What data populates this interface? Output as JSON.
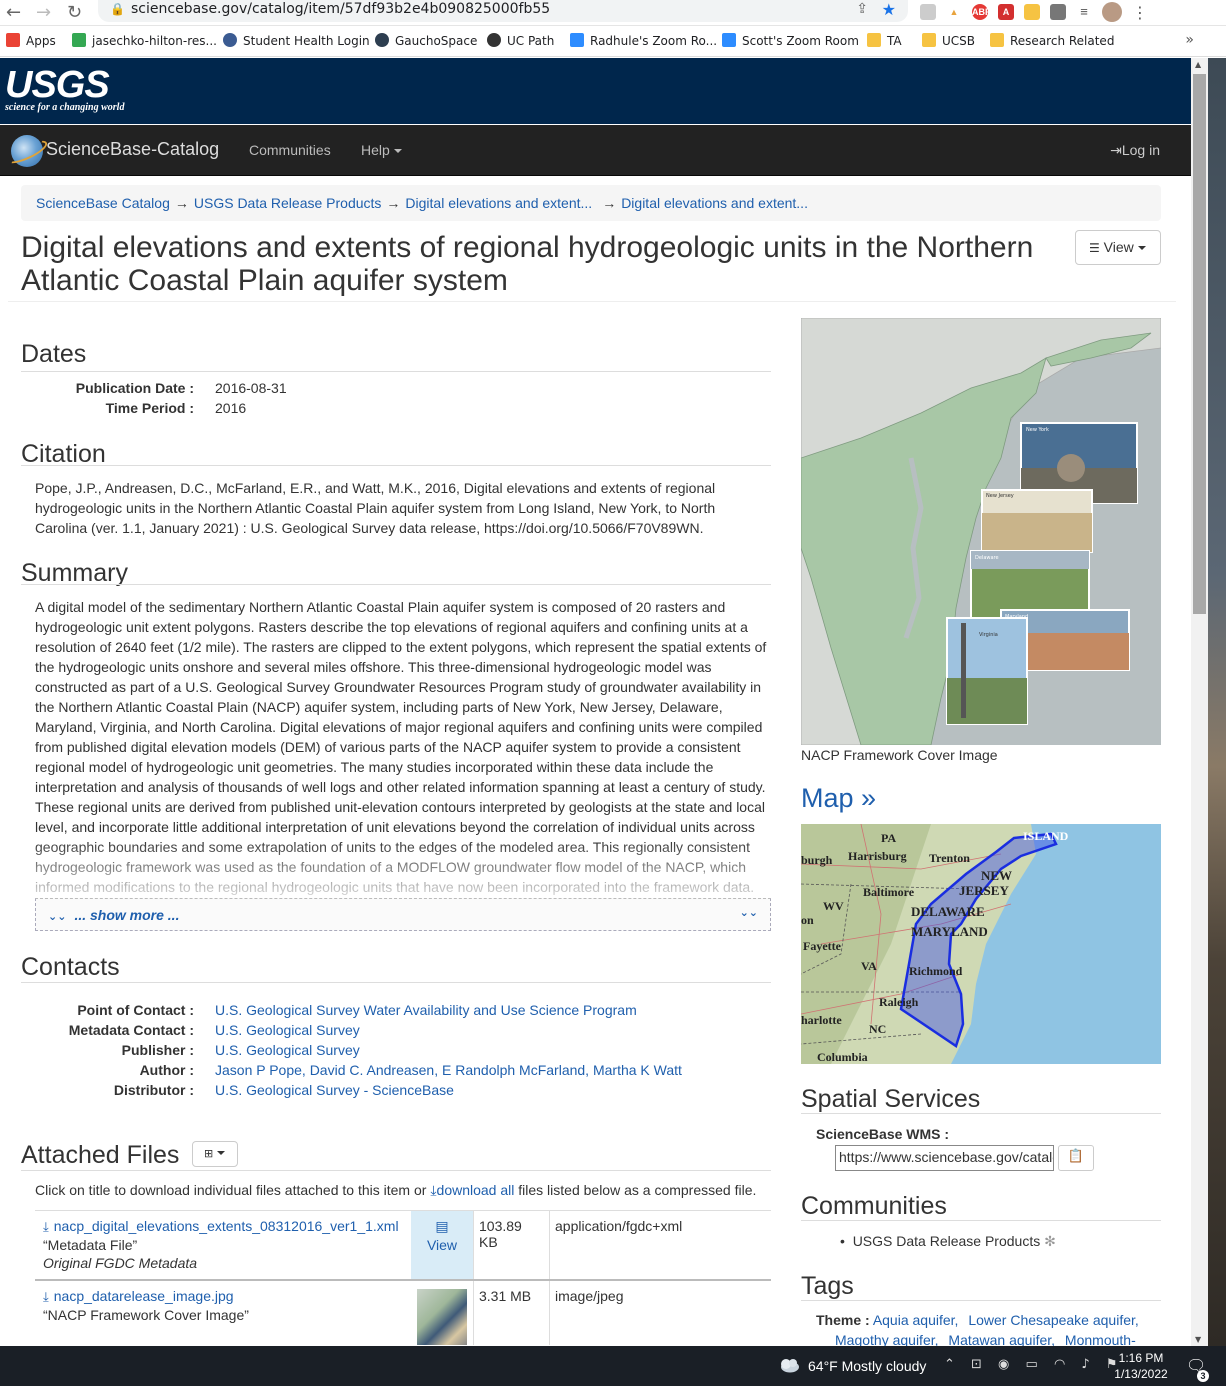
{
  "browser": {
    "url": "sciencebase.gov/catalog/item/57df93b2e4b090825000fb55",
    "bookmarks": [
      {
        "label": "Apps",
        "color": "#ea4335"
      },
      {
        "label": "jasechko-hilton-res...",
        "color": "#34a853"
      },
      {
        "label": "Student Health Login",
        "color": "#3b5b92"
      },
      {
        "label": "GauchoSpace",
        "color": "#2d3e50"
      },
      {
        "label": "UC Path",
        "color": "#333333"
      },
      {
        "label": "Radhule's Zoom Ro...",
        "color": "#2d8cff"
      },
      {
        "label": "Scott's Zoom Room",
        "color": "#2d8cff"
      },
      {
        "label": "TA",
        "color": "#f6c342"
      },
      {
        "label": "UCSB",
        "color": "#f6c342"
      },
      {
        "label": "Research Related",
        "color": "#f6c342"
      }
    ],
    "bookmarks_more": "»"
  },
  "usgs": {
    "wordmark": "USGS",
    "tagline": "science for a changing world"
  },
  "navbar": {
    "brand": "ScienceBase-Catalog",
    "communities": "Communities",
    "help": "Help",
    "login": "Log in"
  },
  "breadcrumb": [
    "ScienceBase Catalog",
    "USGS Data Release Products",
    "Digital elevations and extent...",
    "Digital elevations and extent..."
  ],
  "breadcrumb_sep": "→",
  "title": "Digital elevations and extents of regional hydrogeologic units in the Northern Atlantic Coastal Plain aquifer system",
  "view_button": "View",
  "dates": {
    "heading": "Dates",
    "publication_label": "Publication Date :",
    "publication_value": "2016-08-31",
    "period_label": "Time Period :",
    "period_value": "2016"
  },
  "citation": {
    "heading": "Citation",
    "text": "Pope, J.P., Andreasen, D.C., McFarland, E.R., and Watt, M.K., 2016, Digital elevations and extents of regional hydrogeologic units in the Northern Atlantic Coastal Plain aquifer system from Long Island, New York, to North Carolina (ver. 1.1, January 2021) : U.S. Geological Survey data release, https://doi.org/10.5066/F70V89WN."
  },
  "summary": {
    "heading": "Summary",
    "text": "A digital model of the sedimentary Northern Atlantic Coastal Plain aquifer system is composed of 20 rasters and hydrogeologic unit extent polygons. Rasters describe the top elevations of regional aquifers and confining units at a resolution of 2640 feet (1/2 mile). The rasters are clipped to the extent polygons, which represent the spatial extents of the hydrogeologic units onshore and several miles offshore. This three-dimensional hydrogeologic model was constructed as part of a U.S. Geological Survey Groundwater Resources Program study of groundwater availability in the Northern Atlantic Coastal Plain (NACP) aquifer system, including parts of New York, New Jersey, Delaware, Maryland, Virginia, and North Carolina. Digital elevations of major regional aquifers and confining units were compiled from published digital elevation models (DEM) of various parts of the NACP aquifer system to provide a consistent regional model of hydrogeologic unit geometries. The many studies incorporated within these data include the interpretation and analysis of thousands of well logs and other related information spanning at least a century of study. These regional units are derived from published unit-elevation contours interpreted by geologists at the state and local level, and incorporate little additional interpretation of unit elevations beyond the correlation of individual units across geographic boundaries and some extrapolation of units to the edges of the modeled area. This regionally consistent hydrogeologic framework was used as the foundation of a MODFLOW groundwater flow model of the NACP, which informed modifications to the regional hydrogeologic units that have now been incorporated into the framework data.",
    "show_more": "... show more ..."
  },
  "contacts": {
    "heading": "Contacts",
    "rows": [
      {
        "label": "Point of Contact :",
        "value": "U.S. Geological Survey Water Availability and Use Science Program"
      },
      {
        "label": "Metadata Contact :",
        "value": "U.S. Geological Survey"
      },
      {
        "label": "Publisher :",
        "value": "U.S. Geological Survey"
      },
      {
        "label": "Author :",
        "value": "Jason P Pope, David C. Andreasen, E Randolph McFarland, Martha K Watt"
      },
      {
        "label": "Distributor :",
        "value": "U.S. Geological Survey - ScienceBase"
      }
    ]
  },
  "attached": {
    "heading": "Attached Files",
    "intro_before": "Click on title to download individual files attached to this item or",
    "download_all": "download all",
    "intro_after": "files listed below as a compressed file.",
    "files": [
      {
        "name": "nacp_digital_elevations_extents_08312016_ver1_1.xml",
        "title": "“Metadata File”",
        "desc": "Original FGDC Metadata",
        "action": "View",
        "size": "103.89 KB",
        "type": "application/fgdc+xml"
      },
      {
        "name": "nacp_datarelease_image.jpg",
        "title": "“NACP Framework Cover Image”",
        "desc": "",
        "action": "",
        "size": "3.31 MB",
        "type": "image/jpeg"
      }
    ]
  },
  "right": {
    "cover_caption": "NACP Framework Cover Image",
    "cover_labels": [
      "New York",
      "New Jersey",
      "Delaware",
      "Maryland",
      "Virginia"
    ],
    "map_heading": "Map »",
    "map_labels": [
      "PA",
      "Harrisburg",
      "Trenton",
      "ISLAND",
      "burgh",
      "NEW",
      "JERSEY",
      "Baltimore",
      "DELAWARE",
      "WV",
      "MARYLAND",
      "on",
      "Fayette",
      "VA",
      "Richmond",
      "Raleigh",
      "harlotte",
      "NC",
      "Columbia"
    ],
    "spatial_heading": "Spatial Services",
    "wms_label": "ScienceBase WMS :",
    "wms_value": "https://www.sciencebase.gov/catalog",
    "communities_heading": "Communities",
    "communities": [
      "USGS Data Release Products"
    ],
    "tags_heading": "Tags",
    "theme_label": "Theme :",
    "theme_tags": [
      "Aquia aquifer,",
      "Lower Chesapeake aquifer,",
      "Magothy aquifer,",
      "Matawan aquifer,",
      "Monmouth-"
    ]
  },
  "taskbar": {
    "weather": "64°F  Mostly cloudy",
    "time": "1:16 PM",
    "date": "1/13/2022",
    "notif_count": "3"
  }
}
